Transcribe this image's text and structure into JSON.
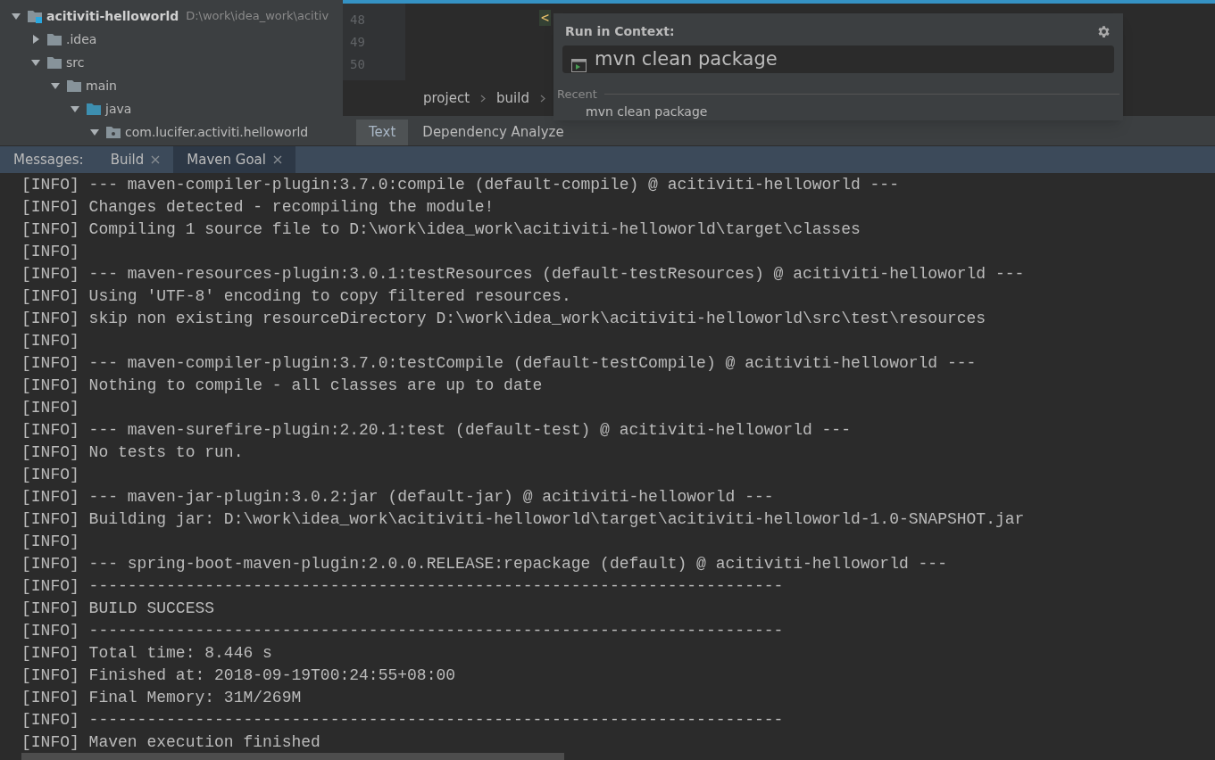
{
  "project_tree": [
    {
      "label": "acitiviti-helloworld",
      "path": "D:\\work\\idea_work\\acitiv",
      "kind": "module",
      "expanded": true,
      "children": [
        {
          "label": ".idea",
          "kind": "folder",
          "expanded": false
        },
        {
          "label": "src",
          "kind": "folder",
          "expanded": true,
          "children": [
            {
              "label": "main",
              "kind": "folder",
              "expanded": true,
              "children": [
                {
                  "label": "java",
                  "kind": "source",
                  "expanded": true,
                  "children": [
                    {
                      "label": "com.lucifer.activiti.helloworld",
                      "kind": "package",
                      "expanded": true
                    }
                  ]
                }
              ]
            }
          ]
        }
      ]
    }
  ],
  "editor": {
    "line_numbers": [
      "48",
      "49",
      "50"
    ],
    "code_fragment": "<",
    "breadcrumbs": [
      "project",
      "build"
    ],
    "tabs": [
      {
        "label": "Text",
        "selected": true
      },
      {
        "label": "Dependency Analyze",
        "selected": false
      }
    ]
  },
  "popup": {
    "title": "Run in Context:",
    "input": {
      "value": "mvn clean package"
    },
    "recent_label": "Recent",
    "recent": [
      "mvn clean package"
    ]
  },
  "messages": {
    "label": "Messages:",
    "tabs": [
      {
        "label": "Build",
        "selected": false
      },
      {
        "label": "Maven Goal",
        "selected": true
      }
    ]
  },
  "console_lines": [
    "[INFO] --- maven-compiler-plugin:3.7.0:compile (default-compile) @ acitiviti-helloworld ---",
    "[INFO] Changes detected - recompiling the module!",
    "[INFO] Compiling 1 source file to D:\\work\\idea_work\\acitiviti-helloworld\\target\\classes",
    "[INFO]",
    "[INFO] --- maven-resources-plugin:3.0.1:testResources (default-testResources) @ acitiviti-helloworld ---",
    "[INFO] Using 'UTF-8' encoding to copy filtered resources.",
    "[INFO] skip non existing resourceDirectory D:\\work\\idea_work\\acitiviti-helloworld\\src\\test\\resources",
    "[INFO]",
    "[INFO] --- maven-compiler-plugin:3.7.0:testCompile (default-testCompile) @ acitiviti-helloworld ---",
    "[INFO] Nothing to compile - all classes are up to date",
    "[INFO]",
    "[INFO] --- maven-surefire-plugin:2.20.1:test (default-test) @ acitiviti-helloworld ---",
    "[INFO] No tests to run.",
    "[INFO]",
    "[INFO] --- maven-jar-plugin:3.0.2:jar (default-jar) @ acitiviti-helloworld ---",
    "[INFO] Building jar: D:\\work\\idea_work\\acitiviti-helloworld\\target\\acitiviti-helloworld-1.0-SNAPSHOT.jar",
    "[INFO]",
    "[INFO] --- spring-boot-maven-plugin:2.0.0.RELEASE:repackage (default) @ acitiviti-helloworld ---",
    "[INFO] ------------------------------------------------------------------------",
    "[INFO] BUILD SUCCESS",
    "[INFO] ------------------------------------------------------------------------",
    "[INFO] Total time: 8.446 s",
    "[INFO] Finished at: 2018-09-19T00:24:55+08:00",
    "[INFO] Final Memory: 31M/269M",
    "[INFO] ------------------------------------------------------------------------",
    "[INFO] Maven execution finished"
  ]
}
